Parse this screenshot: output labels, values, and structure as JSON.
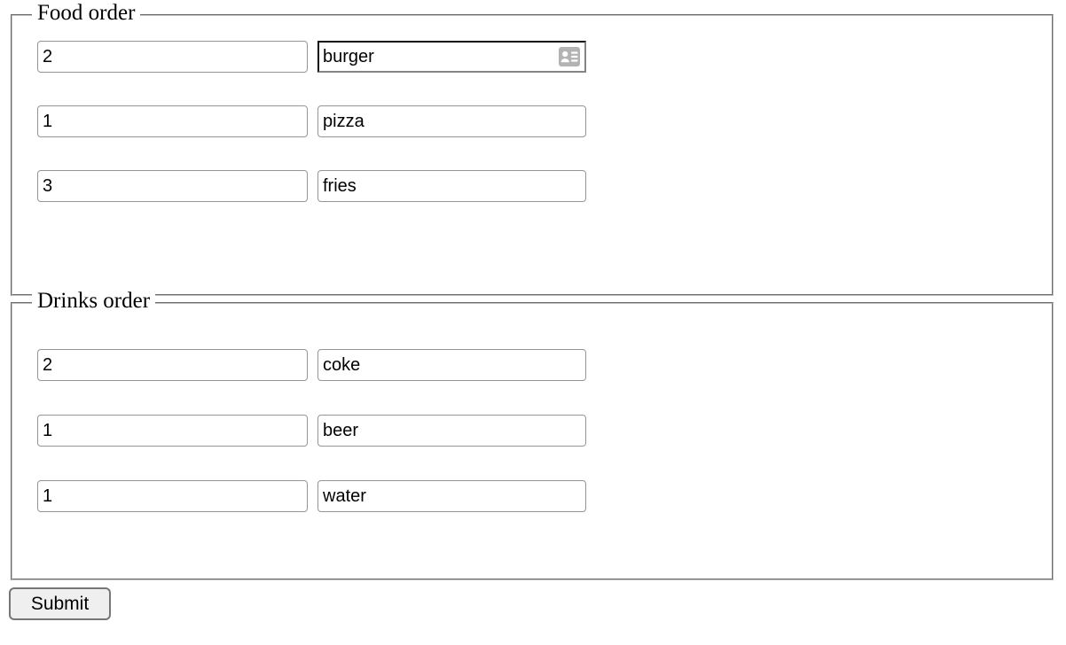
{
  "groups": [
    {
      "legend": "Food order",
      "rows": [
        {
          "quantity": "2",
          "item": "burger",
          "focused": true,
          "icon": "autofill-contact-card-icon"
        },
        {
          "quantity": "1",
          "item": "pizza",
          "focused": false,
          "icon": null
        },
        {
          "quantity": "3",
          "item": "fries",
          "focused": false,
          "icon": null
        }
      ]
    },
    {
      "legend": "Drinks order",
      "rows": [
        {
          "quantity": "2",
          "item": "coke",
          "focused": false,
          "icon": null
        },
        {
          "quantity": "1",
          "item": "beer",
          "focused": false,
          "icon": null
        },
        {
          "quantity": "1",
          "item": "water",
          "focused": false,
          "icon": null
        }
      ]
    }
  ],
  "submit": {
    "label": "Submit"
  },
  "colors": {
    "group_border": "#c0c0c0",
    "field_border": "#959595",
    "focused_field_border": "#0d0d0d",
    "button_face": "#efefef",
    "button_border": "#767676",
    "autofill_icon": "#b3b3b3",
    "text": "#000000",
    "page_background": "#ffffff"
  }
}
